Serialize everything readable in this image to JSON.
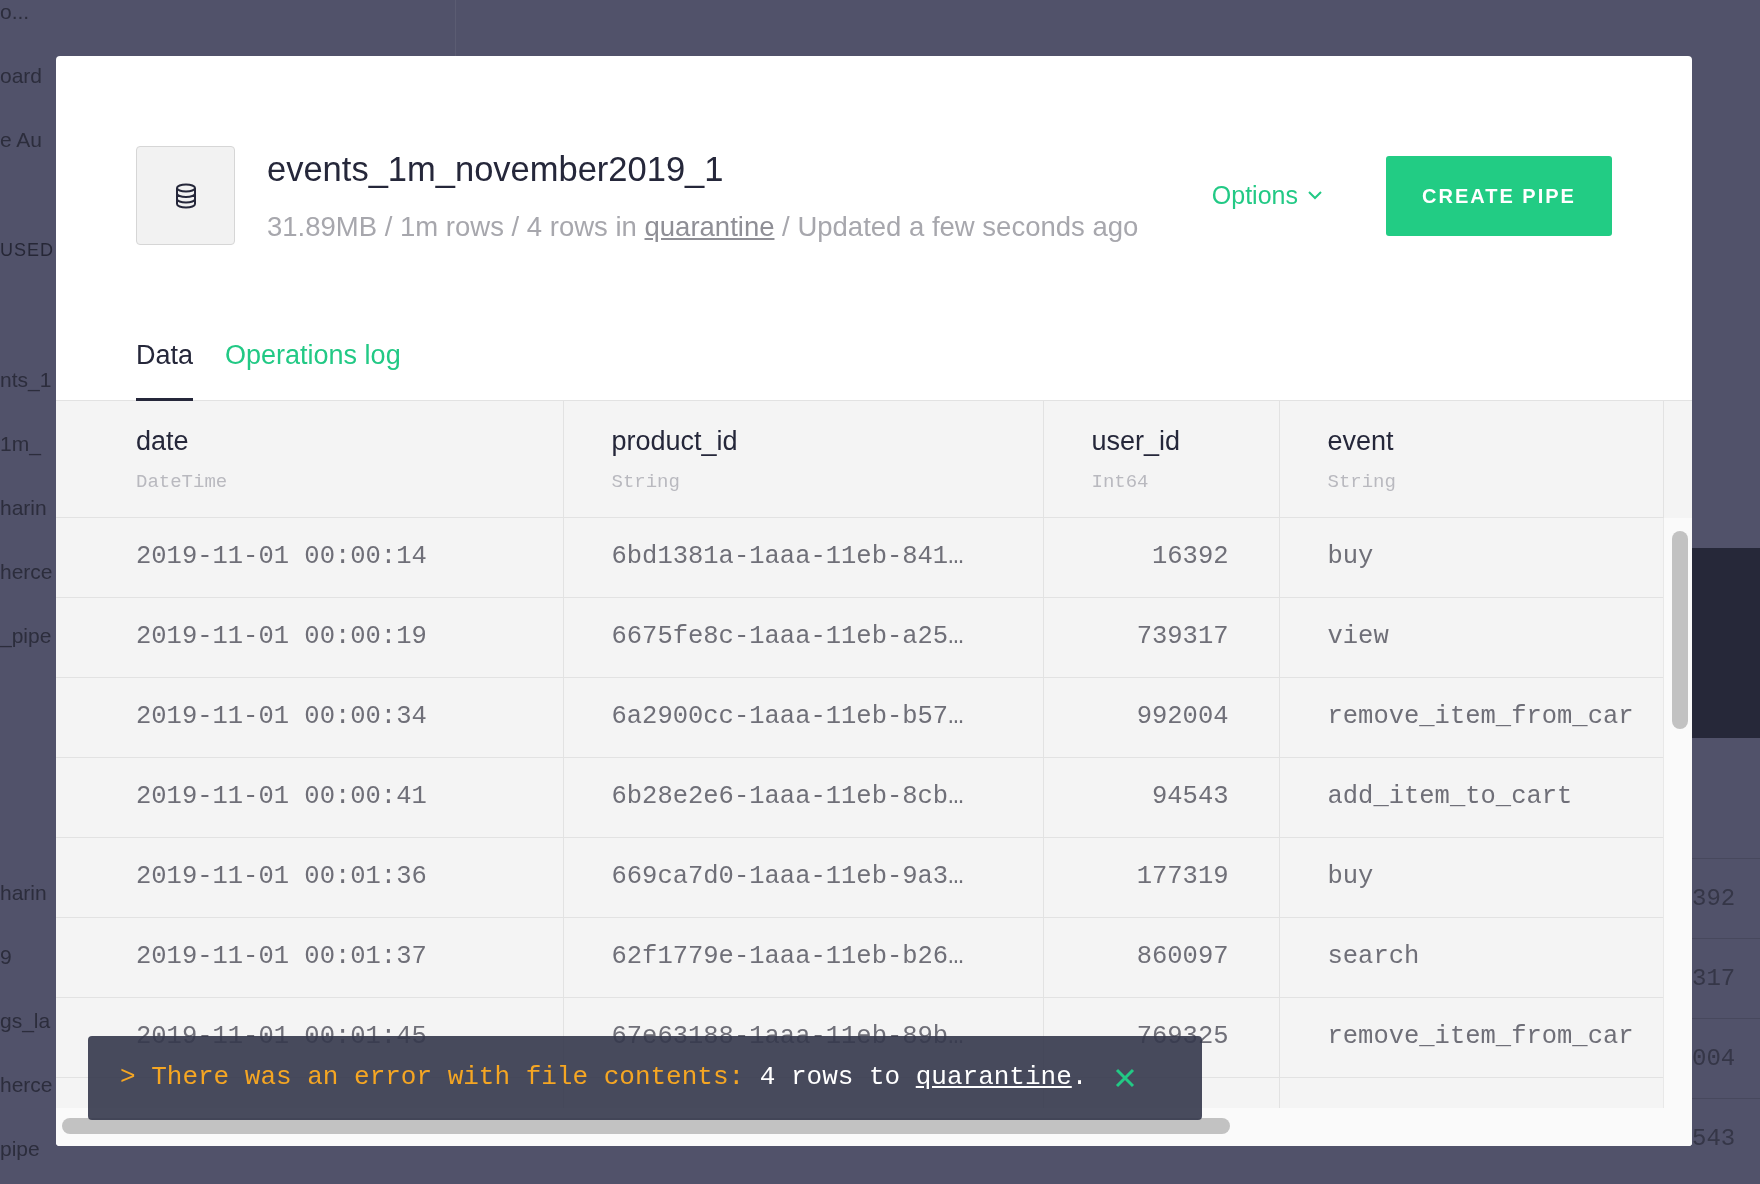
{
  "background": {
    "sidebar_sections": [
      {
        "items": [
          "o...",
          "oard",
          "e Au"
        ]
      },
      {
        "heading": "USED",
        "items": [
          "nts_1",
          "1m_",
          "harin",
          "herce",
          "_pipe"
        ]
      },
      {
        "items": [
          "harin",
          "9",
          "gs_la",
          "herce",
          "pipe"
        ]
      }
    ],
    "right_values": [
      "392",
      "317",
      "004",
      "543"
    ]
  },
  "modal": {
    "title": "events_1m_november2019_1",
    "meta": {
      "prefix": "31.89MB / 1m rows / 4 rows in",
      "quarantine_link": "quarantine",
      "suffix": "/ Updated a few seconds ago"
    },
    "options": "Options",
    "primary_button": "CREATE PIPE",
    "tabs": [
      {
        "label": "Data",
        "selected": true
      },
      {
        "label": "Operations log",
        "selected": false
      }
    ],
    "table": {
      "columns": [
        {
          "name": "date",
          "type": "DateTime",
          "kind": "text"
        },
        {
          "name": "product_id",
          "type": "String",
          "kind": "text"
        },
        {
          "name": "user_id",
          "type": "Int64",
          "kind": "number"
        },
        {
          "name": "event",
          "type": "String",
          "kind": "text"
        }
      ],
      "rows": [
        [
          "2019-11-01 00:00:14",
          "6bd1381a-1aaa-11eb-841…",
          "16392",
          "buy"
        ],
        [
          "2019-11-01 00:00:19",
          "6675fe8c-1aaa-11eb-a25…",
          "739317",
          "view"
        ],
        [
          "2019-11-01 00:00:34",
          "6a2900cc-1aaa-11eb-b57…",
          "992004",
          "remove_item_from_car"
        ],
        [
          "2019-11-01 00:00:41",
          "6b28e2e6-1aaa-11eb-8cb…",
          "94543",
          "add_item_to_cart"
        ],
        [
          "2019-11-01 00:01:36",
          "669ca7d0-1aaa-11eb-9a3…",
          "177319",
          "buy"
        ],
        [
          "2019-11-01 00:01:37",
          "62f1779e-1aaa-11eb-b26…",
          "860097",
          "search"
        ],
        [
          "2019-11-01 00:01:45",
          "67e63188-1aaa-11eb-89b…",
          "769325",
          "remove_item_from_car"
        ]
      ]
    },
    "toast": {
      "prompt": ">",
      "message": "There was an error with file contents:",
      "detail": "4 rows to",
      "link": "quarantine",
      "end": "."
    }
  }
}
